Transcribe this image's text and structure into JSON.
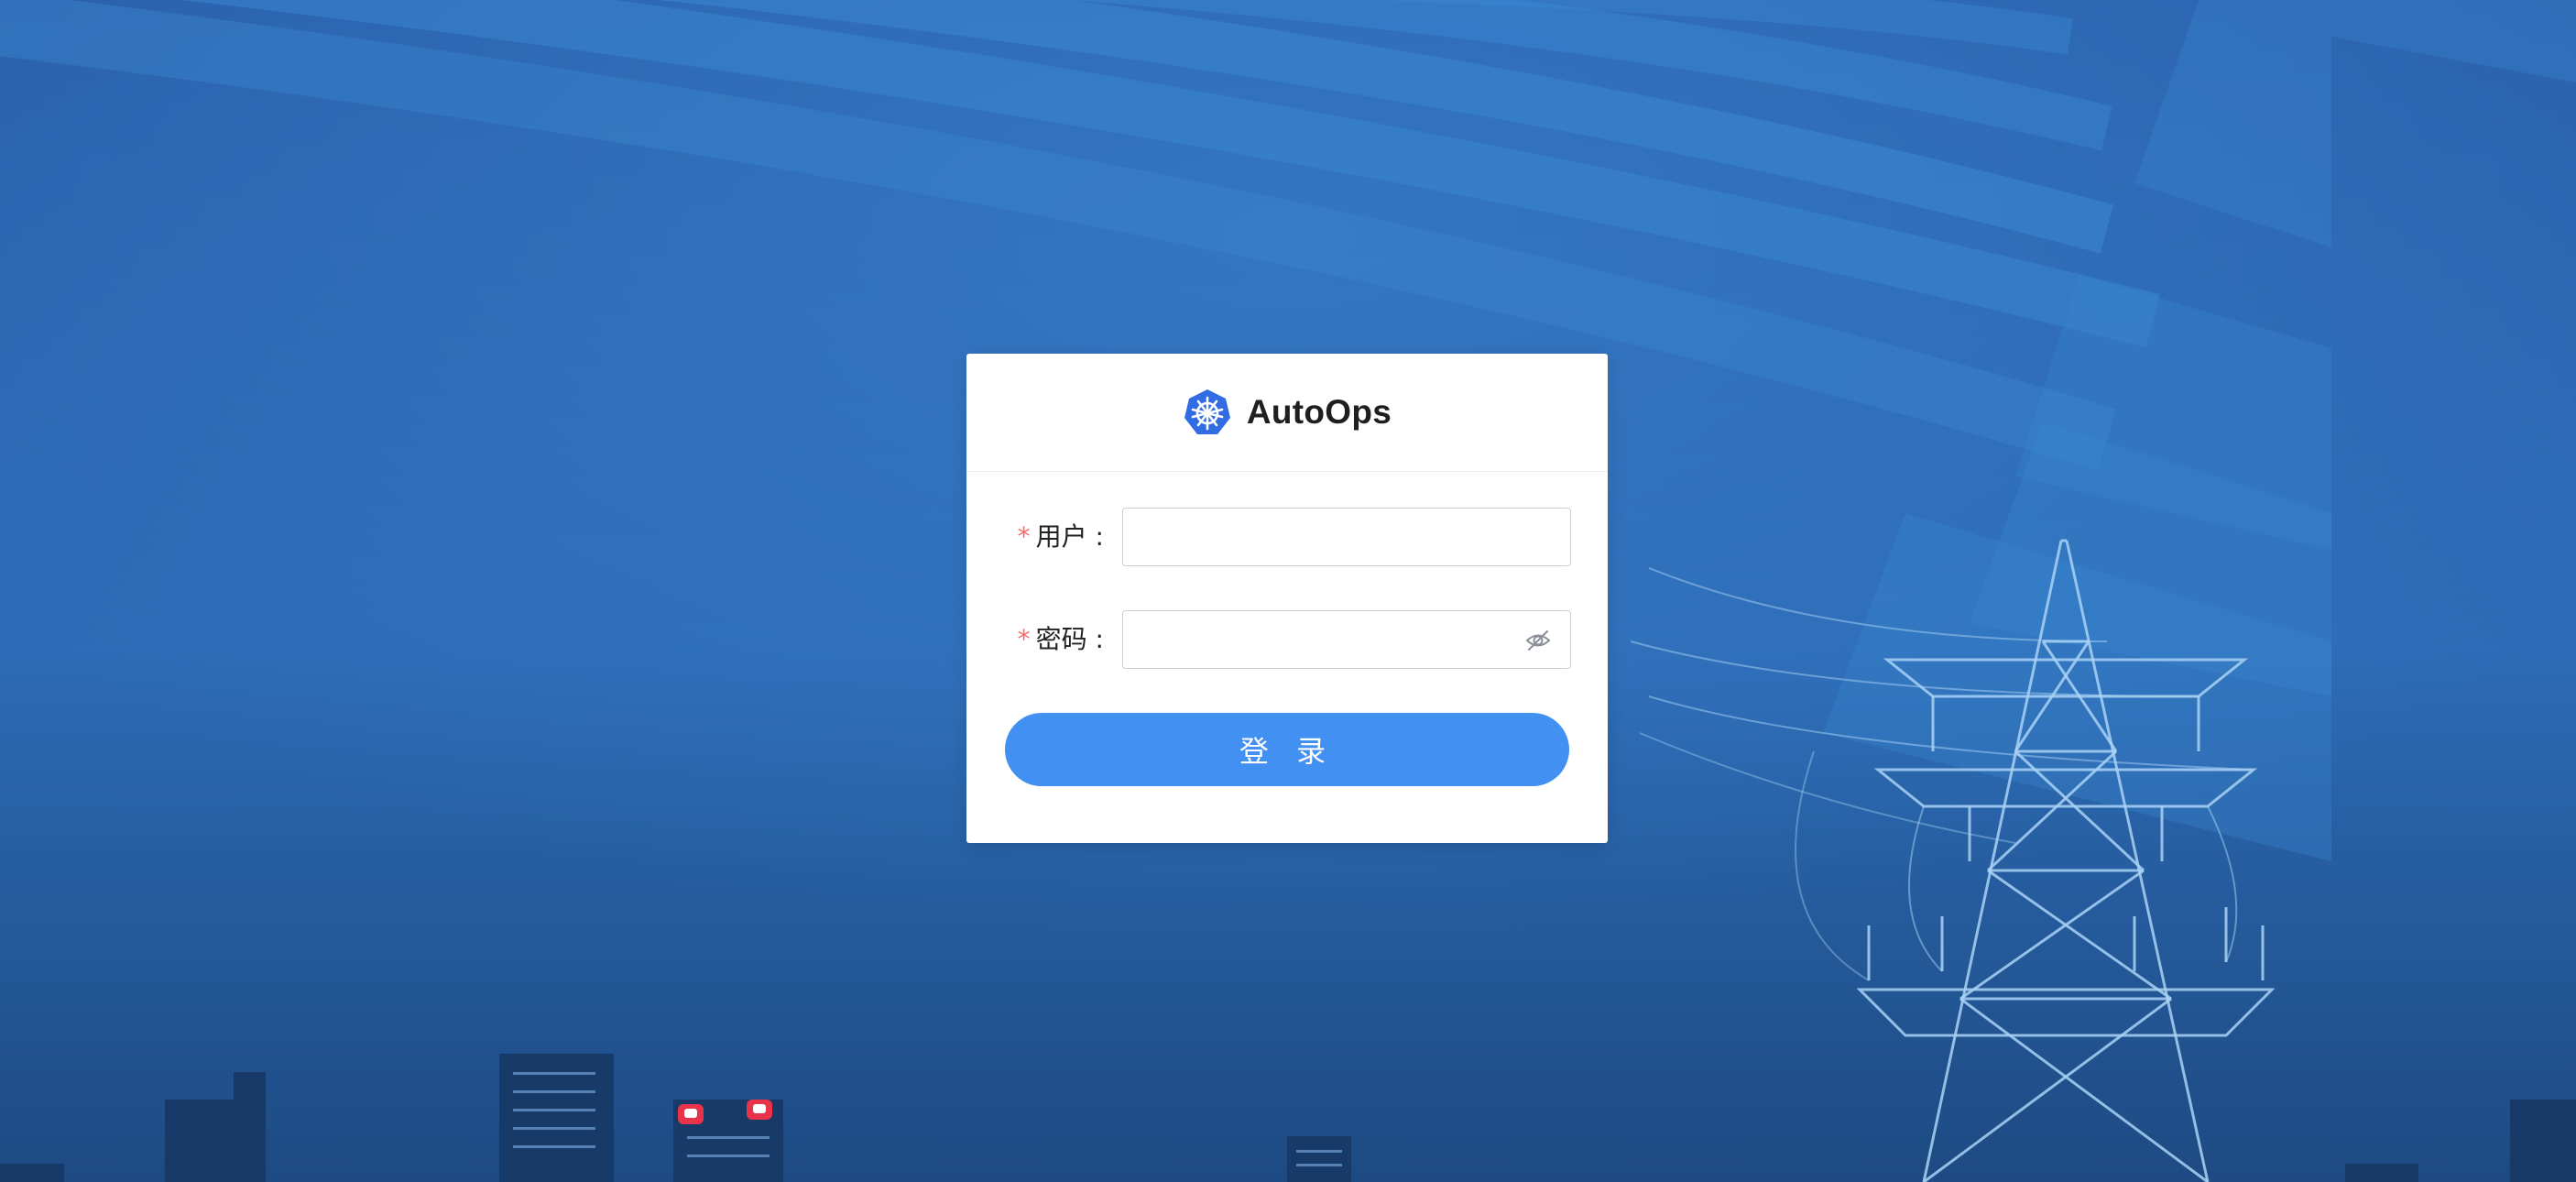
{
  "app": {
    "title": "AutoOps",
    "logo_icon": "kubernetes-helm-icon"
  },
  "form": {
    "username": {
      "required_mark": "*",
      "label": "用户 :",
      "value": "",
      "placeholder": ""
    },
    "password": {
      "required_mark": "*",
      "label": "密码 :",
      "value": "",
      "placeholder": "",
      "toggle_icon": "eye-off-icon"
    },
    "submit_label": "登 录"
  },
  "colors": {
    "primary": "#4190f2",
    "required": "#f56c6c",
    "background": "#2a66b0"
  }
}
